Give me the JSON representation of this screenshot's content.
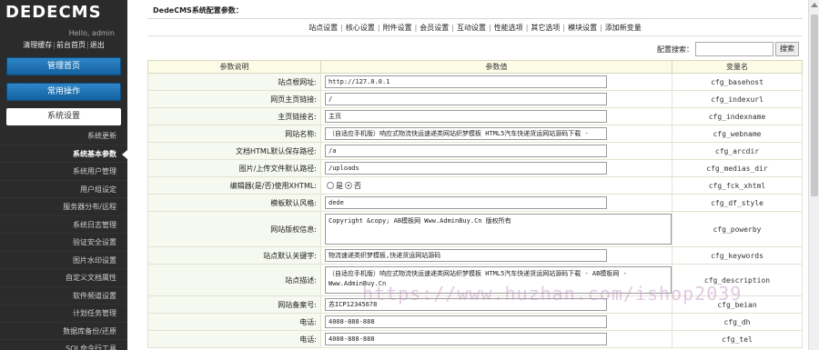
{
  "sidebar": {
    "logo": "DEDECMS",
    "hello": "Hello, admin",
    "links": [
      "清理缓存",
      "前台首页",
      "退出"
    ],
    "nav_home": "管理首页",
    "nav_common": "常用操作",
    "section": "系统设置",
    "items": [
      {
        "label": "系统更新",
        "active": false
      },
      {
        "label": "系统基本参数",
        "active": true
      },
      {
        "label": "系统用户管理",
        "active": false
      },
      {
        "label": "用户组设定",
        "active": false
      },
      {
        "label": "服务器分布/远程",
        "active": false
      },
      {
        "label": "系统日志管理",
        "active": false
      },
      {
        "label": "验证安全设置",
        "active": false
      },
      {
        "label": "图片水印设置",
        "active": false
      },
      {
        "label": "自定义文档属性",
        "active": false
      },
      {
        "label": "软件频道设置",
        "active": false
      },
      {
        "label": "计划任务管理",
        "active": false
      },
      {
        "label": "数据库备份/还原",
        "active": false
      },
      {
        "label": "SQL命令行工具",
        "active": false
      }
    ]
  },
  "main": {
    "title": "DedeCMS系统配置参数：",
    "tabs": [
      "站点设置",
      "核心设置",
      "附件设置",
      "会员设置",
      "互动设置",
      "性能选项",
      "其它选项",
      "模块设置",
      "添加新变量"
    ],
    "search_label": "配置搜索：",
    "search_value": "",
    "search_button": "搜索",
    "columns": [
      "参数说明",
      "参数值",
      "变量名"
    ],
    "rows": [
      {
        "label": "站点根网址:",
        "type": "input",
        "value": "http://127.0.0.1",
        "var": "cfg_basehost"
      },
      {
        "label": "网页主页链接:",
        "type": "input",
        "value": "/",
        "var": "cfg_indexurl"
      },
      {
        "label": "主页链接名:",
        "type": "input",
        "value": "主页",
        "var": "cfg_indexname"
      },
      {
        "label": "网站名称:",
        "type": "input",
        "value": "（自适应手机版）响应式物流快运速递类网站织梦模板 HTML5汽车快递货运网站源码下载 -",
        "var": "cfg_webname"
      },
      {
        "label": "文档HTML默认保存路径:",
        "type": "input",
        "value": "/a",
        "var": "cfg_arcdir"
      },
      {
        "label": "图片/上传文件默认路径:",
        "type": "input",
        "value": "/uploads",
        "var": "cfg_medias_dir"
      },
      {
        "label": "编辑器(是/否)使用XHTML:",
        "type": "radio",
        "options": [
          "是",
          "否"
        ],
        "selected": 1,
        "var": "cfg_fck_xhtml"
      },
      {
        "label": "模板默认风格:",
        "type": "input",
        "value": "dede",
        "var": "cfg_df_style"
      },
      {
        "label": "网站版权信息:",
        "type": "textarea",
        "value": "Copyright &copy; AB模板网 Www.AdminBuy.Cn 版权所有",
        "var": "cfg_powerby"
      },
      {
        "label": "站点默认关键字:",
        "type": "input",
        "value": "物流速递类织梦模板,快递货运网站源码",
        "var": "cfg_keywords"
      },
      {
        "label": "站点描述:",
        "type": "textarea",
        "value": "（自适应手机版）响应式物流快运速递类网站织梦模板 HTML5汽车快递货运网站源码下载 - AB模板网 - Www.AdminBuy.Cn",
        "var": "cfg_description"
      },
      {
        "label": "网站备案号:",
        "type": "input",
        "value": "苏ICP12345678",
        "var": "cfg_beian"
      },
      {
        "label": "电话:",
        "type": "input",
        "value": "4008-888-888",
        "var": "cfg_dh"
      },
      {
        "label": "电话:",
        "type": "input",
        "value": "4008-888-888",
        "var": "cfg_tel"
      }
    ]
  },
  "watermark": "https://www.huzhan.com/ishop2039"
}
